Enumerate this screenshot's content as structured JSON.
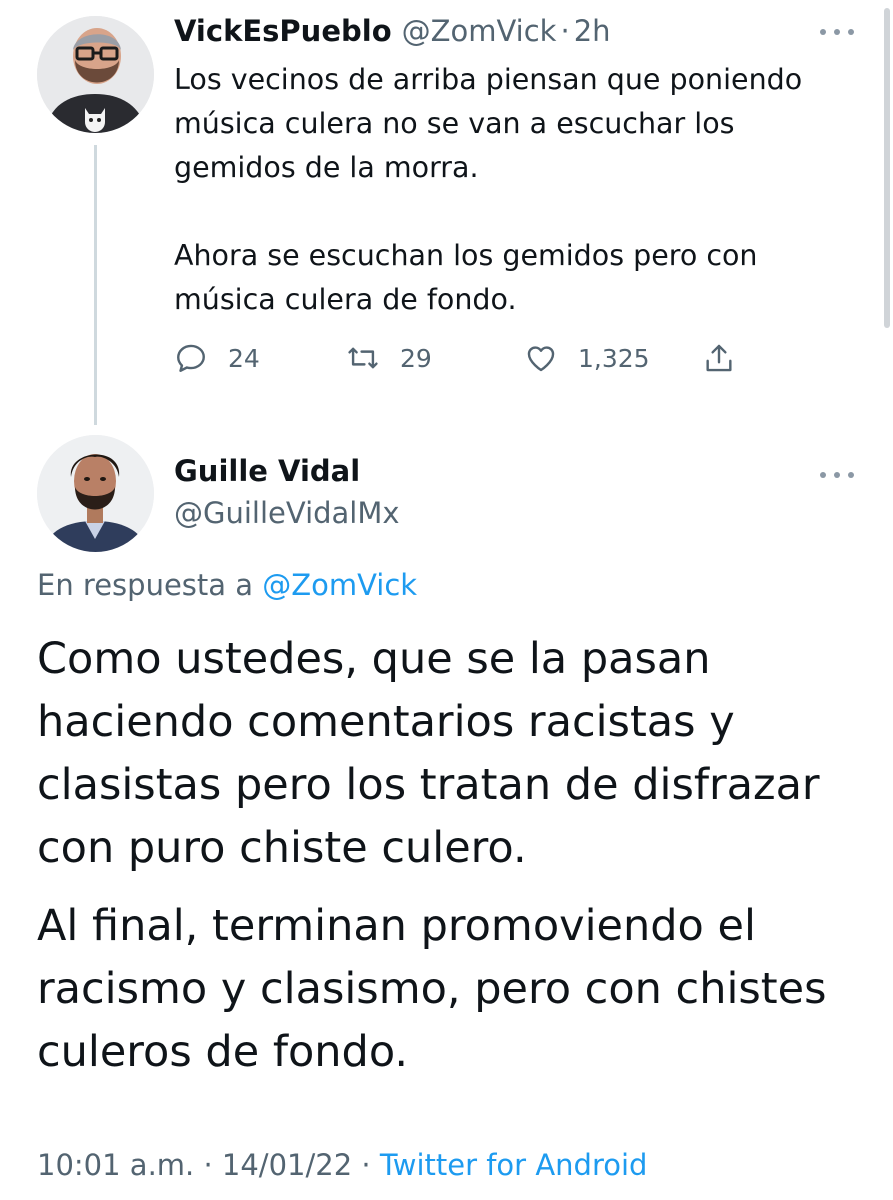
{
  "tweet1": {
    "name": "VickEsPueblo",
    "handle": "@ZomVick",
    "dot": "·",
    "time": "2h",
    "avatar_icon": "avatar-illustration-bearded-man-with-glasses",
    "paragraphs": [
      "Los vecinos de arriba piensan que poniendo música culera no se van a escuchar los gemidos de la morra.",
      "Ahora se escuchan los gemidos pero con música culera de fondo."
    ],
    "replies": "24",
    "retweets": "29",
    "likes": "1,325"
  },
  "tweet2": {
    "name": "Guille Vidal",
    "handle": "@GuilleVidalMx",
    "avatar_icon": "avatar-photo-bearded-man",
    "reply_prefix": "En respuesta a",
    "reply_mention": "@ZomVick",
    "paragraphs": [
      "Como ustedes, que se la pasan haciendo comentarios racistas y clasistas pero los tratan de disfrazar con puro chiste culero.",
      "Al final, terminan promoviendo el racismo y clasismo, pero con chistes culeros de fondo."
    ],
    "time": "10:01 a.m.",
    "sep": "·",
    "date": "14/01/22",
    "source": "Twitter for Android"
  },
  "colors": {
    "text": "#0f1419",
    "muted": "#536471",
    "link": "#1d9bf0",
    "thread_line": "#cfd9de"
  },
  "icons": [
    "more-icon",
    "reply-icon",
    "retweet-icon",
    "like-icon",
    "share-icon"
  ]
}
